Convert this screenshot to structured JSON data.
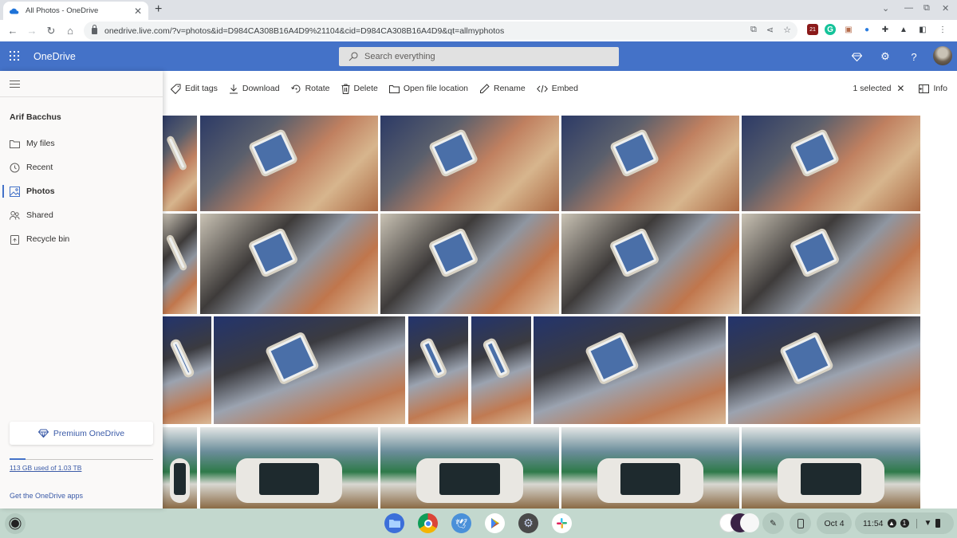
{
  "browser": {
    "tab_title": "All Photos - OneDrive",
    "url": "onedrive.live.com/?v=photos&id=D984CA308B16A4D9%21104&cid=D984CA308B16A4D9&qt=allmyphotos",
    "extension_badge": "21"
  },
  "header": {
    "brand": "OneDrive",
    "search_placeholder": "Search everything",
    "help_label": "?"
  },
  "sidebar": {
    "user_name": "Arif Bacchus",
    "items": [
      {
        "label": "My files",
        "icon": "folder-icon"
      },
      {
        "label": "Recent",
        "icon": "clock-icon"
      },
      {
        "label": "Photos",
        "icon": "image-icon",
        "active": true
      },
      {
        "label": "Shared",
        "icon": "people-icon"
      },
      {
        "label": "Recycle bin",
        "icon": "recycle-bin-icon"
      }
    ],
    "premium_label": "Premium OneDrive",
    "quota_text": "113 GB used of 1.03 TB",
    "quota_used_fraction": 0.11,
    "get_apps": "Get the OneDrive apps"
  },
  "commandbar": {
    "edit_tags": "Edit tags",
    "download": "Download",
    "rotate": "Rotate",
    "delete": "Delete",
    "open_location": "Open file location",
    "rename": "Rename",
    "embed": "Embed",
    "selected": "1 selected",
    "info": "Info"
  },
  "photos": {
    "rows": [
      {
        "count": 5,
        "subject": "man with handheld console"
      },
      {
        "count": 5,
        "subject": "man in cap with handheld console"
      },
      {
        "count": 6,
        "subject": "man in cap seated, handheld console"
      },
      {
        "count": 5,
        "subject": "handheld console on table"
      }
    ]
  },
  "shelf": {
    "date": "Oct 4",
    "time": "11:54",
    "notification_count": "1",
    "apps": [
      "Files",
      "Chrome",
      "Twitter",
      "Play Store",
      "Settings",
      "Slack"
    ]
  }
}
